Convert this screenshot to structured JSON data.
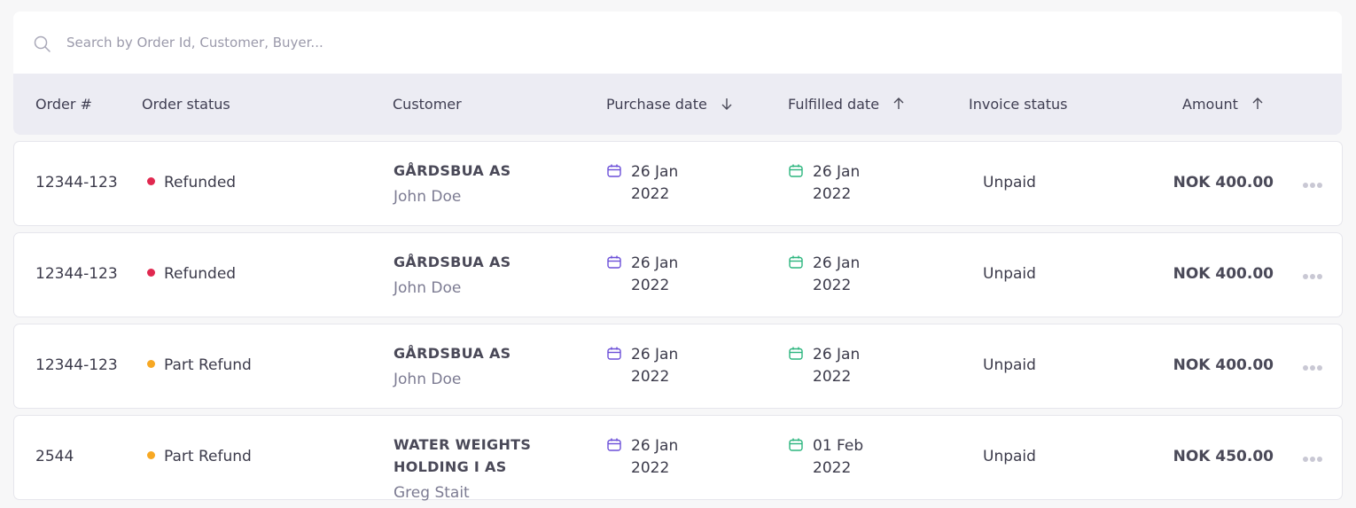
{
  "search": {
    "placeholder": "Search by Order Id, Customer, Buyer..."
  },
  "columns": {
    "order": "Order #",
    "status": "Order status",
    "customer": "Customer",
    "purchase_date": "Purchase date",
    "fulfilled_date": "Fulfilled date",
    "invoice_status": "Invoice status",
    "amount": "Amount"
  },
  "sort_icons": {
    "purchase_date": "arrow-down-icon",
    "fulfilled_date": "arrow-up-icon",
    "amount": "arrow-up-icon"
  },
  "colors": {
    "refunded": "#e0284f",
    "part_refund": "#f7a823",
    "purchase_calendar": "#6b4fd8",
    "fulfilled_calendar": "#2bb57e"
  },
  "rows": [
    {
      "order_id": "12344-123",
      "status": "Refunded",
      "customer_name": "GÅRDSBUA AS",
      "buyer": "John Doe",
      "purchase_day": "26 Jan",
      "purchase_year": "2022",
      "fulfilled_day": "26 Jan",
      "fulfilled_year": "2022",
      "invoice": "Unpaid",
      "amount": "NOK 400.00"
    },
    {
      "order_id": "12344-123",
      "status": "Refunded",
      "customer_name": "GÅRDSBUA AS",
      "buyer": "John Doe",
      "purchase_day": "26 Jan",
      "purchase_year": "2022",
      "fulfilled_day": "26 Jan",
      "fulfilled_year": "2022",
      "invoice": "Unpaid",
      "amount": "NOK 400.00"
    },
    {
      "order_id": "12344-123",
      "status": "Part Refund",
      "customer_name": "GÅRDSBUA AS",
      "buyer": "John Doe",
      "purchase_day": "26 Jan",
      "purchase_year": "2022",
      "fulfilled_day": "26 Jan",
      "fulfilled_year": "2022",
      "invoice": "Unpaid",
      "amount": "NOK 400.00"
    },
    {
      "order_id": "2544",
      "status": "Part Refund",
      "customer_name": "WATER WEIGHTS HOLDING I AS",
      "buyer": "Greg Stait",
      "purchase_day": "26 Jan",
      "purchase_year": "2022",
      "fulfilled_day": "01 Feb",
      "fulfilled_year": "2022",
      "invoice": "Unpaid",
      "amount": "NOK 450.00"
    }
  ]
}
